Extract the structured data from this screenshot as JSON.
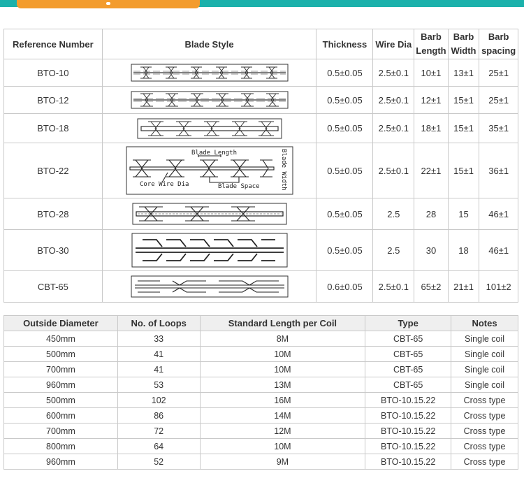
{
  "specs_table": {
    "headers": {
      "reference": "Reference Number",
      "blade_style": "Blade Style",
      "thickness": "Thickness",
      "wire_dia": "Wire Dia",
      "barb_length_1": "Barb",
      "barb_length_2": "Length",
      "barb_width_1": "Barb",
      "barb_width_2": "Width",
      "barb_spacing_1": "Barb",
      "barb_spacing_2": "spacing"
    },
    "rows": [
      {
        "ref": "BTO-10",
        "thickness": "0.5±0.05",
        "wire": "2.5±0.1",
        "length": "10±1",
        "width": "13±1",
        "spacing": "25±1"
      },
      {
        "ref": "BTO-12",
        "thickness": "0.5±0.05",
        "wire": "2.5±0.1",
        "length": "12±1",
        "width": "15±1",
        "spacing": "25±1"
      },
      {
        "ref": "BTO-18",
        "thickness": "0.5±0.05",
        "wire": "2.5±0.1",
        "length": "18±1",
        "width": "15±1",
        "spacing": "35±1"
      },
      {
        "ref": "BTO-22",
        "thickness": "0.5±0.05",
        "wire": "2.5±0.1",
        "length": "22±1",
        "width": "15±1",
        "spacing": "36±1"
      },
      {
        "ref": "BTO-28",
        "thickness": "0.5±0.05",
        "wire": "2.5",
        "length": "28",
        "width": "15",
        "spacing": "46±1"
      },
      {
        "ref": "BTO-30",
        "thickness": "0.5±0.05",
        "wire": "2.5",
        "length": "30",
        "width": "18",
        "spacing": "46±1"
      },
      {
        "ref": "CBT-65",
        "thickness": "0.6±0.05",
        "wire": "2.5±0.1",
        "length": "65±2",
        "width": "21±1",
        "spacing": "101±2"
      }
    ],
    "diagram_labels": {
      "blade_length": "Blade Length",
      "blade_width": "Blade Width",
      "core_wire_dia": "Core Wire Dia",
      "blade_space": "Blade Space"
    }
  },
  "coil_table": {
    "headers": {
      "diameter": "Outside Diameter",
      "loops": "No. of Loops",
      "length": "Standard Length per Coil",
      "type": "Type",
      "notes": "Notes"
    },
    "rows": [
      {
        "diameter": "450mm",
        "loops": "33",
        "length": "8M",
        "type": "CBT-65",
        "notes": "Single coil"
      },
      {
        "diameter": "500mm",
        "loops": "41",
        "length": "10M",
        "type": "CBT-65",
        "notes": "Single coil"
      },
      {
        "diameter": "700mm",
        "loops": "41",
        "length": "10M",
        "type": "CBT-65",
        "notes": "Single coil"
      },
      {
        "diameter": "960mm",
        "loops": "53",
        "length": "13M",
        "type": "CBT-65",
        "notes": "Single coil"
      },
      {
        "diameter": "500mm",
        "loops": "102",
        "length": "16M",
        "type": "BTO-10.15.22",
        "notes": "Cross type"
      },
      {
        "diameter": "600mm",
        "loops": "86",
        "length": "14M",
        "type": "BTO-10.15.22",
        "notes": "Cross type"
      },
      {
        "diameter": "700mm",
        "loops": "72",
        "length": "12M",
        "type": "BTO-10.15.22",
        "notes": "Cross type"
      },
      {
        "diameter": "800mm",
        "loops": "64",
        "length": "10M",
        "type": "BTO-10.15.22",
        "notes": "Cross type"
      },
      {
        "diameter": "960mm",
        "loops": "52",
        "length": "9M",
        "type": "BTO-10.15.22",
        "notes": "Cross type"
      }
    ]
  }
}
